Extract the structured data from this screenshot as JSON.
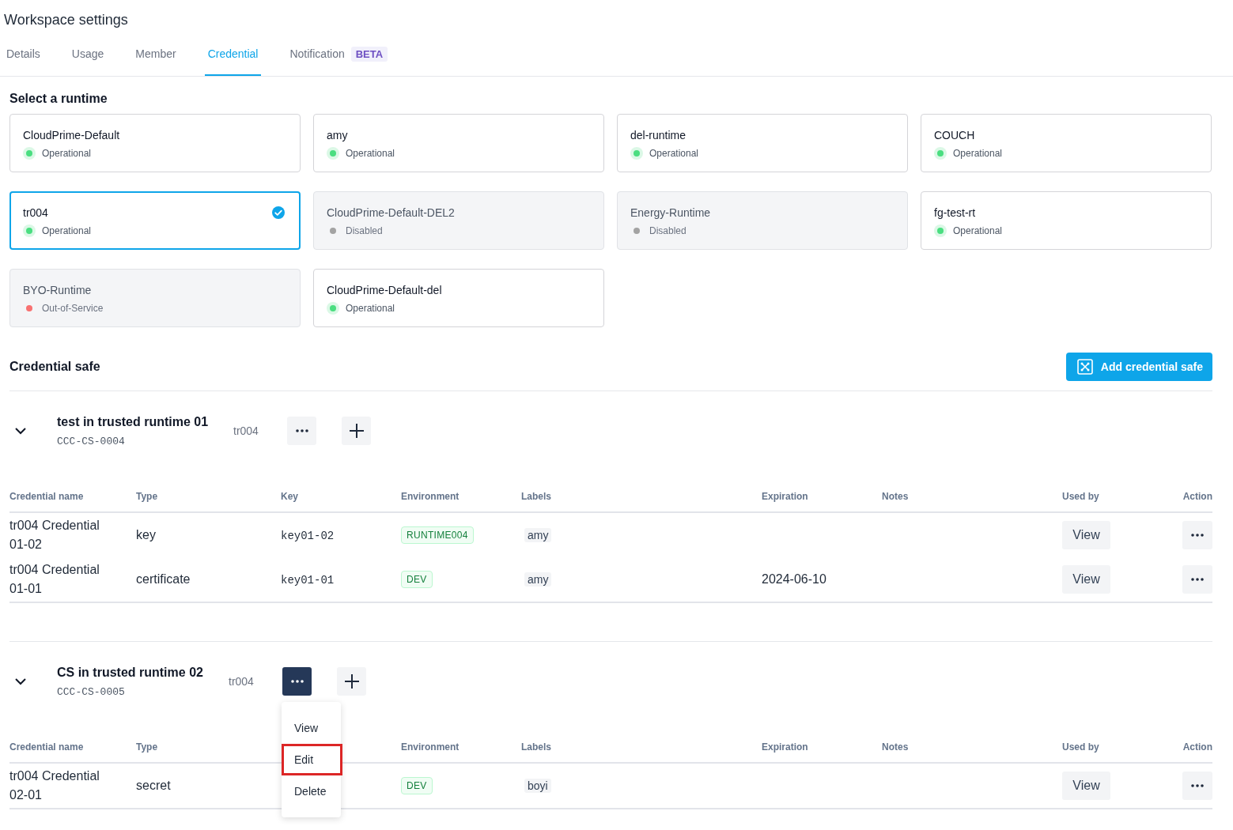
{
  "page": {
    "title": "Workspace settings"
  },
  "tabs": [
    {
      "label": "Details",
      "selected": false
    },
    {
      "label": "Usage",
      "selected": false
    },
    {
      "label": "Member",
      "selected": false
    },
    {
      "label": "Credential",
      "selected": true
    },
    {
      "label": "Notification",
      "selected": false,
      "badge": "BETA"
    }
  ],
  "runtime_section": {
    "title": "Select a runtime"
  },
  "runtimes": [
    {
      "name": "CloudPrime-Default",
      "status": "Operational",
      "color": "#4ade80",
      "disabled": false,
      "selected": false
    },
    {
      "name": "amy",
      "status": "Operational",
      "color": "#4ade80",
      "disabled": false,
      "selected": false
    },
    {
      "name": "del-runtime",
      "status": "Operational",
      "color": "#4ade80",
      "disabled": false,
      "selected": false
    },
    {
      "name": "COUCH",
      "status": "Operational",
      "color": "#4ade80",
      "disabled": false,
      "selected": false
    },
    {
      "name": "tr004",
      "status": "Operational",
      "color": "#4ade80",
      "disabled": false,
      "selected": true
    },
    {
      "name": "CloudPrime-Default-DEL2",
      "status": "Disabled",
      "color": "#a3a3a3",
      "disabled": true,
      "selected": false
    },
    {
      "name": "Energy-Runtime",
      "status": "Disabled",
      "color": "#a3a3a3",
      "disabled": true,
      "selected": false
    },
    {
      "name": "fg-test-rt",
      "status": "Operational",
      "color": "#4ade80",
      "disabled": false,
      "selected": false
    },
    {
      "name": "BYO-Runtime",
      "status": "Out-of-Service",
      "color": "#f87171",
      "disabled": true,
      "selected": false
    },
    {
      "name": "CloudPrime-Default-del",
      "status": "Operational",
      "color": "#4ade80",
      "disabled": false,
      "selected": false
    }
  ],
  "credential_safe": {
    "title": "Credential safe",
    "add_button": "Add credential safe"
  },
  "safes": [
    {
      "name": "test in trusted runtime 01",
      "code": "CCC-CS-0004",
      "runtime": "tr004",
      "expanded": true,
      "menu_open": false,
      "columns": [
        "Credential name",
        "Type",
        "Key",
        "Environment",
        "Labels",
        "Expiration",
        "Notes",
        "Used by",
        "Action"
      ],
      "rows": [
        {
          "name": "tr004 Credential 01-02",
          "type": "key",
          "key": "key01-02",
          "environment": "RUNTIME004",
          "label": "amy",
          "used_by": "View"
        },
        {
          "name": "tr004 Credential 01-01",
          "type": "certificate",
          "key": "key01-01",
          "environment": "DEV",
          "label": "amy",
          "expiration": "2024-06-10",
          "used_by": "View"
        }
      ]
    },
    {
      "name": "CS in trusted runtime 02",
      "code": "CCC-CS-0005",
      "runtime": "tr004",
      "expanded": true,
      "menu_open": true,
      "menu": [
        {
          "label": "View",
          "highlighted": false
        },
        {
          "label": "Edit",
          "highlighted": true
        },
        {
          "label": "Delete",
          "highlighted": false
        }
      ],
      "columns": [
        "Credential name",
        "Type",
        "Environment",
        "Labels",
        "Expiration",
        "Notes",
        "Used by",
        "Action"
      ],
      "rows": [
        {
          "name": "tr004 Credential 02-01",
          "type": "secret",
          "environment": "DEV",
          "label": "boyi",
          "used_by": "View"
        }
      ]
    }
  ]
}
